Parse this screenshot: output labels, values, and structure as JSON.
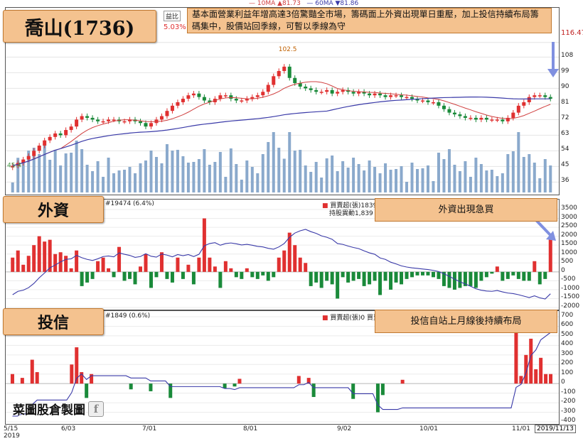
{
  "legend_top": {
    "ma10": "10MA ▲81.73",
    "ma60": "60MA ▼81.86"
  },
  "stock_title": "喬山(1736)",
  "corner_label": "益比",
  "corner_pct": "5.03%",
  "annotation_main": "基本面營業利益年增高達3倍驚豔全市場，籌碼面上外資出現單日重壓，加上投信持續布局籌碼集中，股價站回季線，可暫以季線為守",
  "last_price": "116.47",
  "peak_label": "102.5",
  "low_label": "45.4",
  "foreign": {
    "tag": "外資",
    "header": "#19474 (6.4%)",
    "buysell": "買賣超(張)1839 買",
    "hold": "持股異動1,839",
    "note": "外資出現急買"
  },
  "trust": {
    "tag": "投信",
    "header": "#1849 (0.6%)",
    "buysell": "買賣超(張)0 買賣",
    "note": "投信自站上月線後持續布局"
  },
  "watermark": "菜圖股倉製圖",
  "date_badge": "2019/11/13",
  "colors": {
    "up": "#e03030",
    "down": "#1a8a3a",
    "ma": "#3a3aa8",
    "vol": "#8aa9cc",
    "tag": "#f4c28f"
  },
  "chart_data": [
    {
      "type": "candlestick",
      "title": "喬山(1736)",
      "yticks": [
        36,
        45,
        54,
        63,
        72,
        81,
        90,
        99,
        108,
        116.47
      ],
      "ylim": [
        30,
        118
      ],
      "xticks": [
        "5/15\n2019",
        "6/03",
        "7/01",
        "8/01",
        "9/02",
        "10/01",
        "11/01"
      ],
      "close": [
        45.4,
        47,
        49,
        51,
        54,
        57,
        60,
        62,
        64,
        63,
        66,
        68,
        72,
        74,
        73,
        72,
        71,
        71,
        72,
        72,
        71,
        71,
        72,
        71,
        70,
        68,
        70,
        72,
        74,
        77,
        80,
        82,
        84,
        86,
        87,
        85,
        83,
        82,
        84,
        86,
        86,
        84,
        83,
        83,
        84,
        85,
        86,
        88,
        92,
        97,
        100,
        102.5,
        96,
        93,
        91,
        90,
        89,
        88,
        88,
        89,
        87,
        88,
        89,
        88,
        87,
        88,
        87,
        86,
        87,
        86,
        85,
        86,
        86,
        85,
        85,
        84,
        83,
        83,
        82,
        82,
        80,
        78,
        76,
        75,
        74,
        73,
        73,
        72,
        73,
        72,
        72,
        72,
        71,
        73,
        76,
        80,
        82,
        85,
        86,
        86,
        85,
        84
      ]
    },
    {
      "type": "bar",
      "title": "外資",
      "yticks": [
        3500,
        3000,
        2500,
        2000,
        1500,
        1000,
        500,
        0,
        -500,
        -1000,
        -1500,
        -2000
      ],
      "ylim": [
        -2000,
        3500
      ],
      "values": [
        800,
        1200,
        400,
        900,
        1500,
        2000,
        1700,
        1800,
        1000,
        1100,
        900,
        200,
        1200,
        -800,
        -600,
        -400,
        600,
        800,
        200,
        -300,
        1400,
        -500,
        -400,
        -700,
        300,
        1000,
        -900,
        -300,
        1100,
        -400,
        -600,
        800,
        -400,
        400,
        -700,
        800,
        3000,
        800,
        300,
        -900,
        600,
        200,
        -300,
        -400,
        200,
        -300,
        -400,
        -200,
        -500,
        -300,
        800,
        1200,
        2200,
        1500,
        800,
        500,
        -800,
        -600,
        -900,
        -500,
        -700,
        -1500,
        -300,
        -600,
        -500,
        -400,
        -800,
        -700,
        -500,
        -1300,
        -500,
        -1000,
        -600,
        -700,
        -400,
        -300,
        -200,
        -200,
        -200,
        -300,
        -400,
        -800,
        -900,
        -1000,
        -900,
        -800,
        -800,
        -900,
        -500,
        -300,
        -100,
        300,
        -500,
        -400,
        -200,
        -400,
        -500,
        -500,
        600,
        -700,
        -400,
        1839
      ]
    },
    {
      "type": "bar",
      "title": "投信",
      "yticks": [
        700,
        600,
        500,
        400,
        300,
        200,
        100,
        0,
        -100,
        -200,
        -300,
        -400
      ],
      "ylim": [
        -400,
        700
      ],
      "values": [
        100,
        0,
        60,
        0,
        250,
        120,
        0,
        0,
        0,
        0,
        0,
        0,
        200,
        380,
        120,
        -150,
        100,
        0,
        0,
        0,
        0,
        0,
        0,
        0,
        -60,
        0,
        0,
        0,
        -80,
        0,
        0,
        0,
        -150,
        0,
        0,
        0,
        0,
        0,
        0,
        0,
        0,
        0,
        0,
        -50,
        0,
        -30,
        50,
        0,
        0,
        0,
        0,
        0,
        0,
        0,
        0,
        0,
        0,
        0,
        80,
        0,
        60,
        -140,
        0,
        0,
        0,
        0,
        0,
        0,
        0,
        -160,
        0,
        0,
        0,
        0,
        -300,
        -120,
        0,
        0,
        0,
        40,
        0,
        0,
        0,
        0,
        0,
        0,
        0,
        0,
        0,
        0,
        0,
        0,
        0,
        0,
        0,
        0,
        0,
        0,
        0,
        0,
        0,
        0,
        550,
        80,
        300,
        470,
        150,
        270,
        100,
        100
      ]
    }
  ]
}
